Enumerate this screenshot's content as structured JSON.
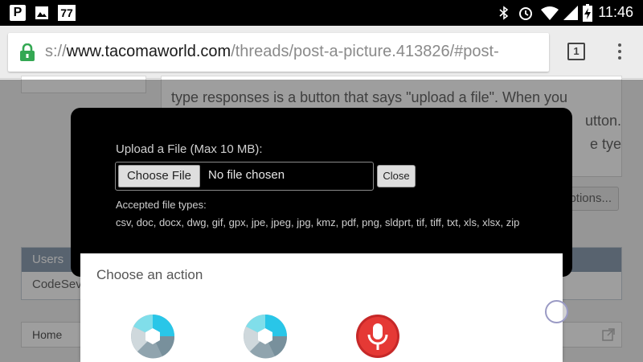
{
  "status_bar": {
    "notif_p": "P",
    "notif_77": "77",
    "time": "11:46"
  },
  "browser": {
    "url_scheme": "s://",
    "url_host": "www.tacomaworld.com",
    "url_path": "/threads/post-a-picture.413826/#post-",
    "tab_count": "1"
  },
  "page": {
    "post_text": "type responses is a button that says \"upload a file\". When you",
    "post_text_2": "utton.",
    "post_text_3": "e tye",
    "more_options": "ptions...",
    "users_header": "Users",
    "users_body": "CodeSev",
    "breadcrumb_home": "Home"
  },
  "upload_modal": {
    "title": "Upload a File (Max 10 MB):",
    "choose_button": "Choose File",
    "file_status": "No file chosen",
    "close_button": "Close",
    "accepted_label": "Accepted file types:",
    "accepted_types": "csv, doc, docx, dwg, gif, gpx, jpe, jpeg, jpg, kmz, pdf, png, sldprt, tif, tiff, txt, xls, xlsx, zip"
  },
  "action_sheet": {
    "title": "Choose an action",
    "apps": [
      {
        "icon": "camera-aperture-icon"
      },
      {
        "icon": "camera-aperture-icon"
      },
      {
        "icon": "microphone-recorder-icon"
      }
    ]
  },
  "colors": {
    "status_bar": "#000000",
    "modal_bg": "#000000",
    "users_header": "#8ea0b3",
    "lock_green": "#34a853",
    "camera_cyan": "#29c6e8",
    "mic_red": "#c62828"
  }
}
